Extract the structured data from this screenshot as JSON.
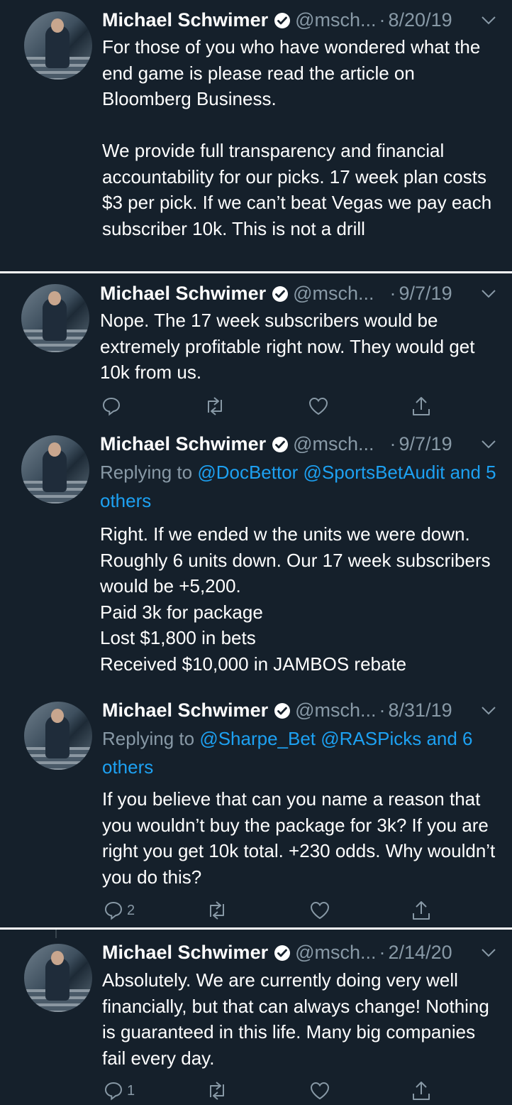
{
  "tweets": [
    {
      "name": "Michael Schwimer",
      "handle": "@msch...",
      "sep": "·",
      "date": "8/20/19",
      "text": "For those of you who have wondered what the end game is please read the article on Bloomberg Business.\n\nWe provide full transparency and financial accountability for our picks. 17 week plan costs $3 per pick. If we can’t beat Vegas we pay each subscriber 10k. This is not a drill"
    },
    {
      "name": "Michael Schwimer",
      "handle": "@msch...",
      "sep": "·",
      "date": "9/7/19",
      "text": "Nope. The 17 week subscribers would be extremely profitable right now. They would get 10k from us.",
      "reply_count": ""
    },
    {
      "name": "Michael Schwimer",
      "handle": "@msch...",
      "sep": "·",
      "date": "9/7/19",
      "replying_prefix": "Replying to ",
      "replying_link": "@DocBettor @SportsBetAudit and 5 others",
      "text": "Right. If we ended w the units we were down. Roughly 6 units down. Our 17 week subscribers would be +5,200.\nPaid 3k for package\nLost $1,800 in bets\nReceived $10,000 in JAMBOS rebate"
    },
    {
      "name": "Michael Schwimer",
      "handle": "@msch...",
      "sep": "·",
      "date": "8/31/19",
      "replying_prefix": "Replying to ",
      "replying_link": "@Sharpe_Bet @RASPicks and 6 others",
      "text": "If you believe that can you name a reason that you wouldn’t buy the package for 3k? If you are right you get 10k total. +230 odds. Why wouldn’t you do this?",
      "reply_count": "2"
    },
    {
      "name": "Michael Schwimer",
      "handle": "@msch...",
      "sep": "·",
      "date": "2/14/20",
      "text": "Absolutely.  We are currently doing very well financially, but that can always change! Nothing is guaranteed in this life. Many big companies fail every day.",
      "reply_count": "1"
    }
  ],
  "colors": {
    "background": "#15202b",
    "secondary_text": "#8899a6",
    "link": "#1da1f2",
    "divider": "#ffffff"
  },
  "icons": [
    "verified-icon",
    "chevron-down-icon",
    "reply-icon",
    "retweet-icon",
    "like-icon",
    "share-icon"
  ]
}
